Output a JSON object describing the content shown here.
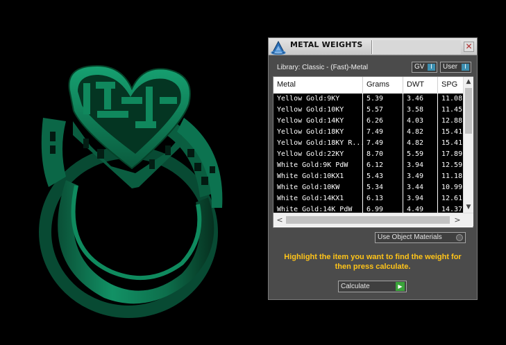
{
  "viewport": {
    "subject_icon": "ring-3d-model-icon",
    "ring_color": "#0d7a52"
  },
  "panel": {
    "title": "METAL WEIGHTS",
    "app_icon": "jewelry-cad-logo-icon",
    "close_glyph": "✕",
    "library_label": "Library: Classic - (Fast)-Metal",
    "toggles": {
      "gv": "GV",
      "user": "User",
      "toggle_glyph": "I"
    },
    "table": {
      "columns": [
        "Metal",
        "Grams",
        "DWT",
        "SPG"
      ],
      "rows": [
        [
          "Yellow Gold:9KY",
          "5.39",
          "3.46",
          "11.08"
        ],
        [
          "Yellow Gold:10KY",
          "5.57",
          "3.58",
          "11.45"
        ],
        [
          "Yellow Gold:14KY",
          "6.26",
          "4.03",
          "12.88"
        ],
        [
          "Yellow Gold:18KY",
          "7.49",
          "4.82",
          "15.41"
        ],
        [
          "Yellow Gold:18KY R...",
          "7.49",
          "4.82",
          "15.41"
        ],
        [
          "Yellow Gold:22KY",
          "8.70",
          "5.59",
          "17.89"
        ],
        [
          "White Gold:9K PdW",
          "6.12",
          "3.94",
          "12.59"
        ],
        [
          "White Gold:10KX1",
          "5.43",
          "3.49",
          "11.18"
        ],
        [
          "White Gold:10KW",
          "5.34",
          "3.44",
          "10.99"
        ],
        [
          "White Gold:14KX1",
          "6.13",
          "3.94",
          "12.61"
        ],
        [
          "White Gold:14K PdW",
          "6.99",
          "4.49",
          "14.37"
        ]
      ],
      "scroll_glyphs": {
        "up": "▲",
        "down": "▼",
        "left": "<",
        "right": ">"
      }
    },
    "use_object_materials": "Use Object Materials",
    "hint": "Highlight the item you want to find the weight for then press calculate.",
    "calculate": "Calculate",
    "play_glyph": "▶",
    "colors": {
      "hint_text": "#ffc419",
      "toggle_accent": "#3d8fb0",
      "play_button": "#3aa43a"
    }
  }
}
